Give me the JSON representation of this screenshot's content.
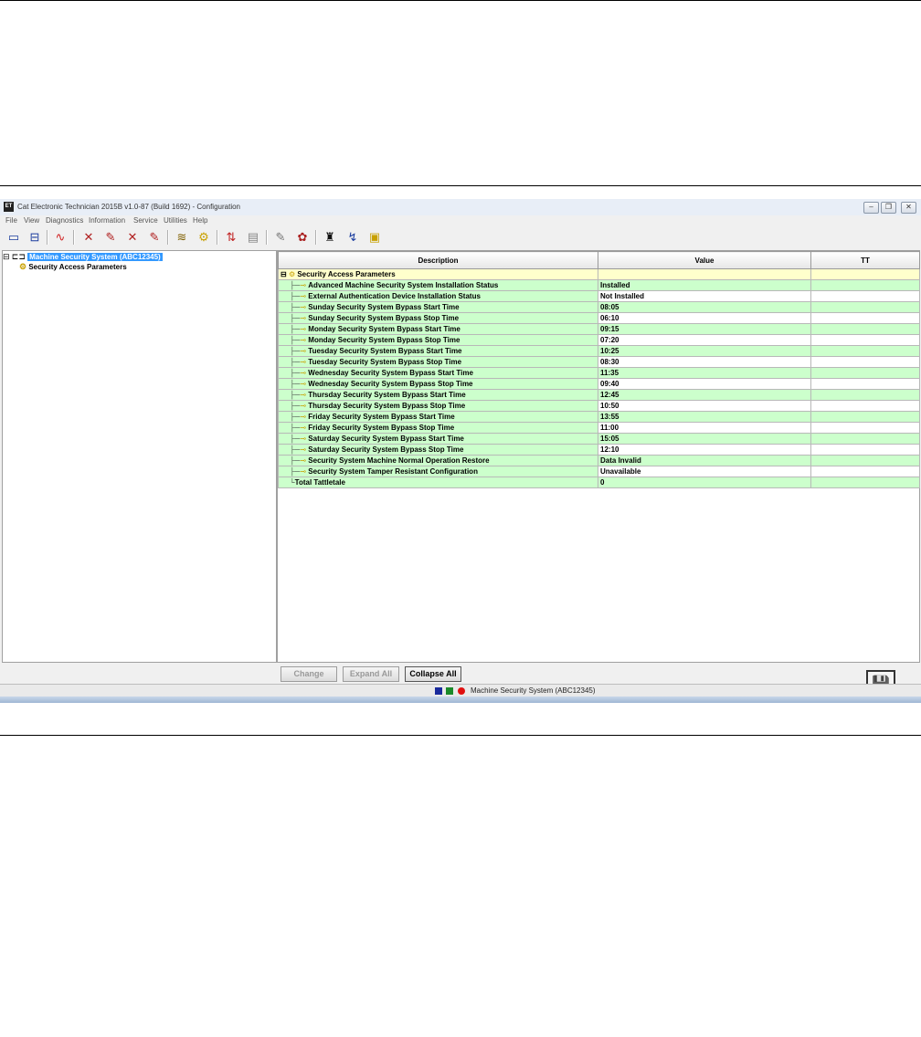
{
  "window": {
    "title": "Cat Electronic Technician 2015B v1.0-87 (Build 1692) - Configuration",
    "app_icon": "ET"
  },
  "menu": [
    "File",
    "View",
    "Diagnostics",
    "Information",
    "Service",
    "Utilities",
    "Help"
  ],
  "toolbar_icons": [
    "print-icon",
    "print-preview-icon",
    "graph-icon",
    "diagnostic-codes-icon",
    "event-codes-icon",
    "logged-codes-icon",
    "clear-codes-icon",
    "status-groups-icon",
    "config-icon",
    "compare-icon",
    "paste-icon",
    "edit-icon",
    "calibrate-icon",
    "binoculars-icon",
    "connect-icon",
    "flash-icon"
  ],
  "tree": {
    "root": "Machine Security System (ABC12345)",
    "child": "Security Access Parameters"
  },
  "table": {
    "headers": [
      "Description",
      "Value",
      "TT"
    ],
    "group": "Security Access Parameters",
    "rows": [
      {
        "desc": "Advanced Machine Security System Installation Status",
        "value": "Installed"
      },
      {
        "desc": "External Authentication Device Installation Status",
        "value": "Not Installed"
      },
      {
        "desc": "Sunday Security System Bypass Start Time",
        "value": "08:05"
      },
      {
        "desc": "Sunday Security System Bypass Stop Time",
        "value": "06:10"
      },
      {
        "desc": "Monday Security System Bypass Start Time",
        "value": "09:15"
      },
      {
        "desc": "Monday Security System Bypass Stop Time",
        "value": "07:20"
      },
      {
        "desc": "Tuesday Security System Bypass Start Time",
        "value": "10:25"
      },
      {
        "desc": "Tuesday Security System Bypass Stop Time",
        "value": "08:30"
      },
      {
        "desc": "Wednesday Security System Bypass Start Time",
        "value": "11:35"
      },
      {
        "desc": "Wednesday Security System Bypass Stop Time",
        "value": "09:40"
      },
      {
        "desc": "Thursday Security System Bypass Start Time",
        "value": "12:45"
      },
      {
        "desc": "Thursday Security System Bypass Stop Time",
        "value": "10:50"
      },
      {
        "desc": "Friday Security System Bypass Start Time",
        "value": "13:55"
      },
      {
        "desc": "Friday Security System Bypass Stop Time",
        "value": "11:00"
      },
      {
        "desc": "Saturday Security System Bypass Start Time",
        "value": "15:05"
      },
      {
        "desc": "Saturday Security System Bypass Stop Time",
        "value": "12:10"
      },
      {
        "desc": "Security System Machine Normal Operation Restore",
        "value": "Data Invalid"
      },
      {
        "desc": "Security System Tamper Resistant Configuration",
        "value": "Unavailable"
      },
      {
        "desc": "Total Tattletale",
        "value": "0"
      }
    ]
  },
  "buttons": {
    "change": "Change",
    "expand_all": "Expand All",
    "collapse_all": "Collapse All"
  },
  "status": {
    "text": "Machine Security System (ABC12345)",
    "colors": {
      "blue": "#1a2b9c",
      "green": "#1b8a2a",
      "red": "#e01010"
    }
  }
}
